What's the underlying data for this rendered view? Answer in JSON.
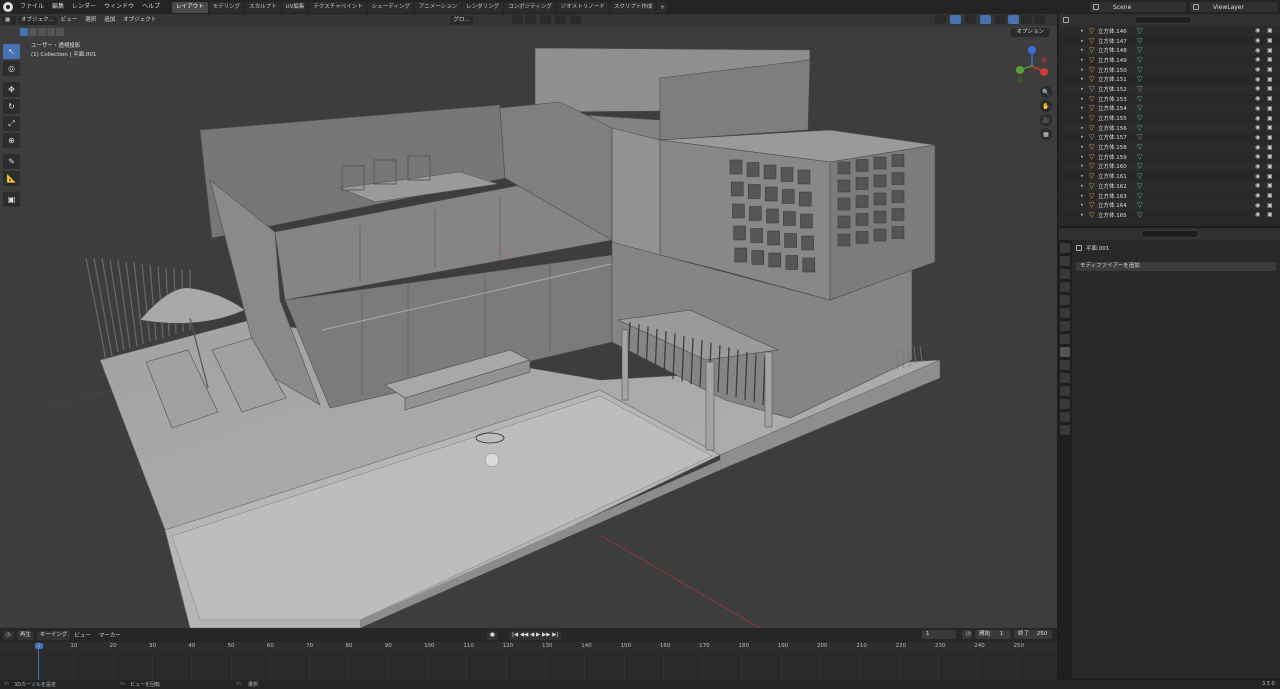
{
  "menu": [
    "ファイル",
    "編集",
    "レンダー",
    "ウィンドウ",
    "ヘルプ"
  ],
  "workspace_tabs": [
    "レイアウト",
    "モデリング",
    "スカルプト",
    "UV編集",
    "テクスチャペイント",
    "シェーディング",
    "アニメーション",
    "レンダリング",
    "コンポジティング",
    "ジオメトリノード",
    "スクリプト作成"
  ],
  "active_tab_index": 0,
  "scene": "Scene",
  "view_layer": "ViewLayer",
  "viewport": {
    "mode": "オブジェク...",
    "menus": [
      "ビュー",
      "選択",
      "追加",
      "オブジェクト"
    ],
    "orientation": "グロ...",
    "view_name": "ユーザー・透視投影",
    "collection_line": "(1) Collection | 平面.001",
    "options": "オプション"
  },
  "outliner": {
    "items": [
      "立方体.146",
      "立方体.147",
      "立方体.148",
      "立方体.149",
      "立方体.150",
      "立方体.151",
      "立方体.152",
      "立方体.153",
      "立方体.154",
      "立方体.155",
      "立方体.156",
      "立方体.157",
      "立方体.158",
      "立方体.159",
      "立方体.160",
      "立方体.161",
      "立方体.162",
      "立方体.163",
      "立方体.164",
      "立方体.165"
    ]
  },
  "properties": {
    "object_name": "平面.001",
    "add_modifier": "モディファイアーを追加"
  },
  "timeline": {
    "menus": [
      "再生",
      "キーイング",
      "ビュー",
      "マーカー"
    ],
    "current_frame": "1",
    "start_label": "開始",
    "start": "1",
    "end_label": "終了",
    "end": "250",
    "ticks": [
      "1",
      "10",
      "20",
      "30",
      "40",
      "50",
      "60",
      "70",
      "80",
      "90",
      "100",
      "110",
      "120",
      "130",
      "140",
      "150",
      "160",
      "170",
      "180",
      "190",
      "200",
      "210",
      "220",
      "230",
      "240",
      "250"
    ]
  },
  "status": {
    "left": "3Dカーソルを設定",
    "middle": "ビューを回転",
    "right": "選択",
    "version": "3.5.0"
  }
}
